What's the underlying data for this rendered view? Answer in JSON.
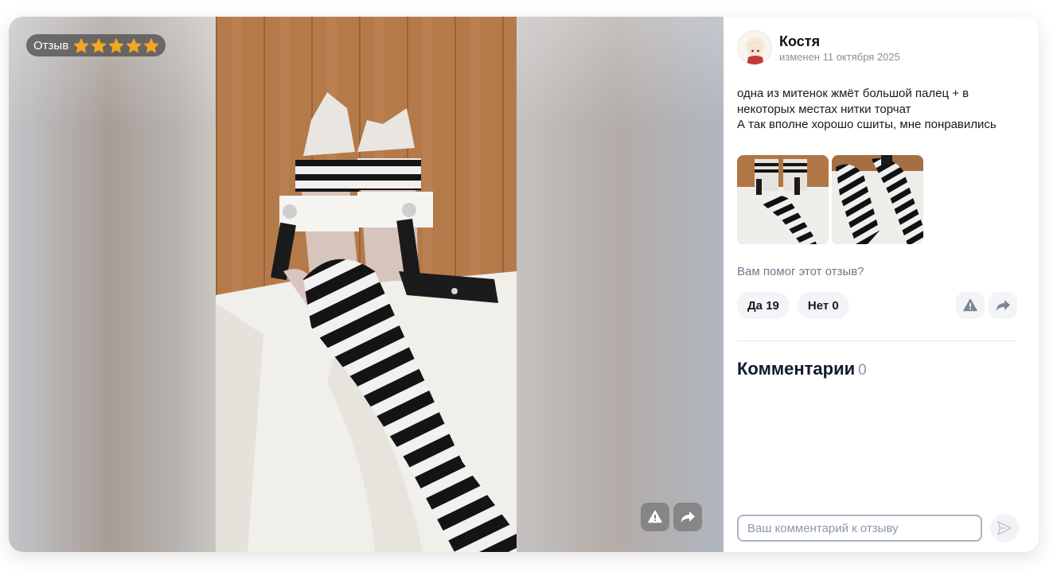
{
  "media": {
    "rating_label": "Отзыв",
    "rating": 5,
    "rating_max": 5,
    "star_color": "#f5a623"
  },
  "review": {
    "author": "Костя",
    "edited": "изменен 11 октября 2025",
    "text_lines": [
      "одна из митенок жмёт большой палец + в",
      "некоторых местах нитки торчат",
      "А так вполне хорошо сшиты, мне понравились"
    ]
  },
  "helpful": {
    "question": "Вам помог этот отзыв?",
    "yes_label": "Да 19",
    "no_label": "Нет 0"
  },
  "comments": {
    "title": "Комментарии",
    "count": "0",
    "input_placeholder": "Ваш комментарий к отзыву"
  },
  "icons": {
    "report": "warning-icon",
    "share": "share-icon",
    "send": "send-icon"
  }
}
